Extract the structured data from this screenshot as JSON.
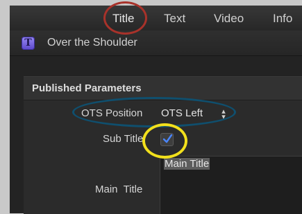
{
  "tabs": [
    {
      "label": "Title",
      "active": true
    },
    {
      "label": "Text",
      "active": false
    },
    {
      "label": "Video",
      "active": false
    },
    {
      "label": "Info",
      "active": false
    }
  ],
  "clip": {
    "title": "Over the Shoulder",
    "icon": "title-generator-icon"
  },
  "section": {
    "title": "Published Parameters"
  },
  "params": {
    "ots_position": {
      "label": "OTS Position",
      "value": "OTS Left"
    },
    "sub_title": {
      "label": "Sub Title",
      "checked": true
    },
    "main_title": {
      "label": "Main  Title",
      "value": "Main Title"
    }
  },
  "annotations": {
    "colors": {
      "red": "#a8322a",
      "blue": "#0f4f6e",
      "yellow": "#f2e01c"
    }
  }
}
